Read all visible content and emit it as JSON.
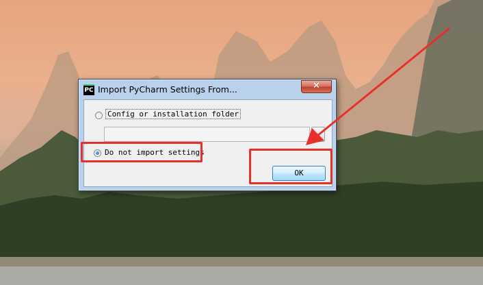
{
  "dialog": {
    "title": "Import PyCharm Settings From...",
    "app_icon_text": "PC",
    "close_icon": "close-icon",
    "options": [
      {
        "label": "Config or installation folder",
        "selected": false
      },
      {
        "label": "Do not import settings",
        "selected": true
      }
    ],
    "path_value": "",
    "ok_label": "OK"
  },
  "annotations": {
    "highlight_color": "#e8302a"
  }
}
